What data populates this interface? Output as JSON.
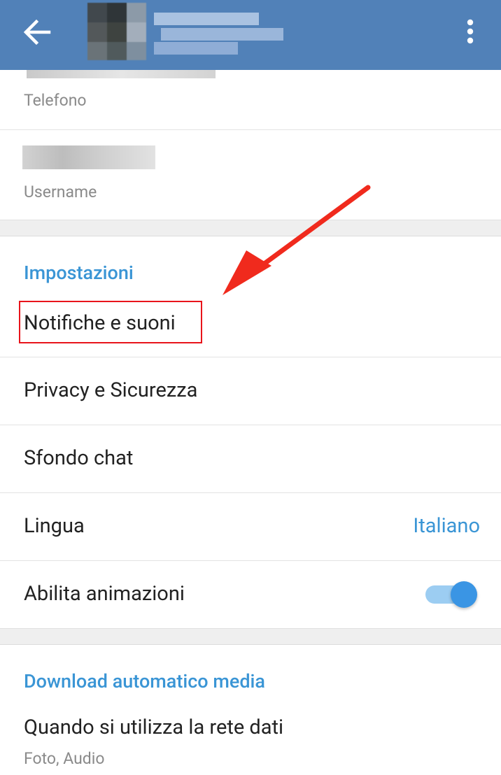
{
  "toolbar": {
    "back_icon": "arrow-left-icon",
    "menu_icon": "more-vertical-icon",
    "color": "#5181b8"
  },
  "profile": {
    "phone_label": "Telefono",
    "username_label": "Username"
  },
  "settings": {
    "header": "Impostazioni",
    "items": [
      {
        "label": "Notifiche e suoni"
      },
      {
        "label": "Privacy e Sicurezza"
      },
      {
        "label": "Sfondo chat"
      },
      {
        "label": "Lingua",
        "value": "Italiano"
      },
      {
        "label": "Abilita animazioni",
        "toggle": true
      }
    ]
  },
  "media": {
    "header": "Download automatico media",
    "items": [
      {
        "label": "Quando si utilizza la rete dati",
        "sub": "Foto, Audio"
      }
    ]
  },
  "annotation": {
    "color": "#e8141b",
    "target": "Notifiche e suoni"
  },
  "accent": "#3a95d5"
}
